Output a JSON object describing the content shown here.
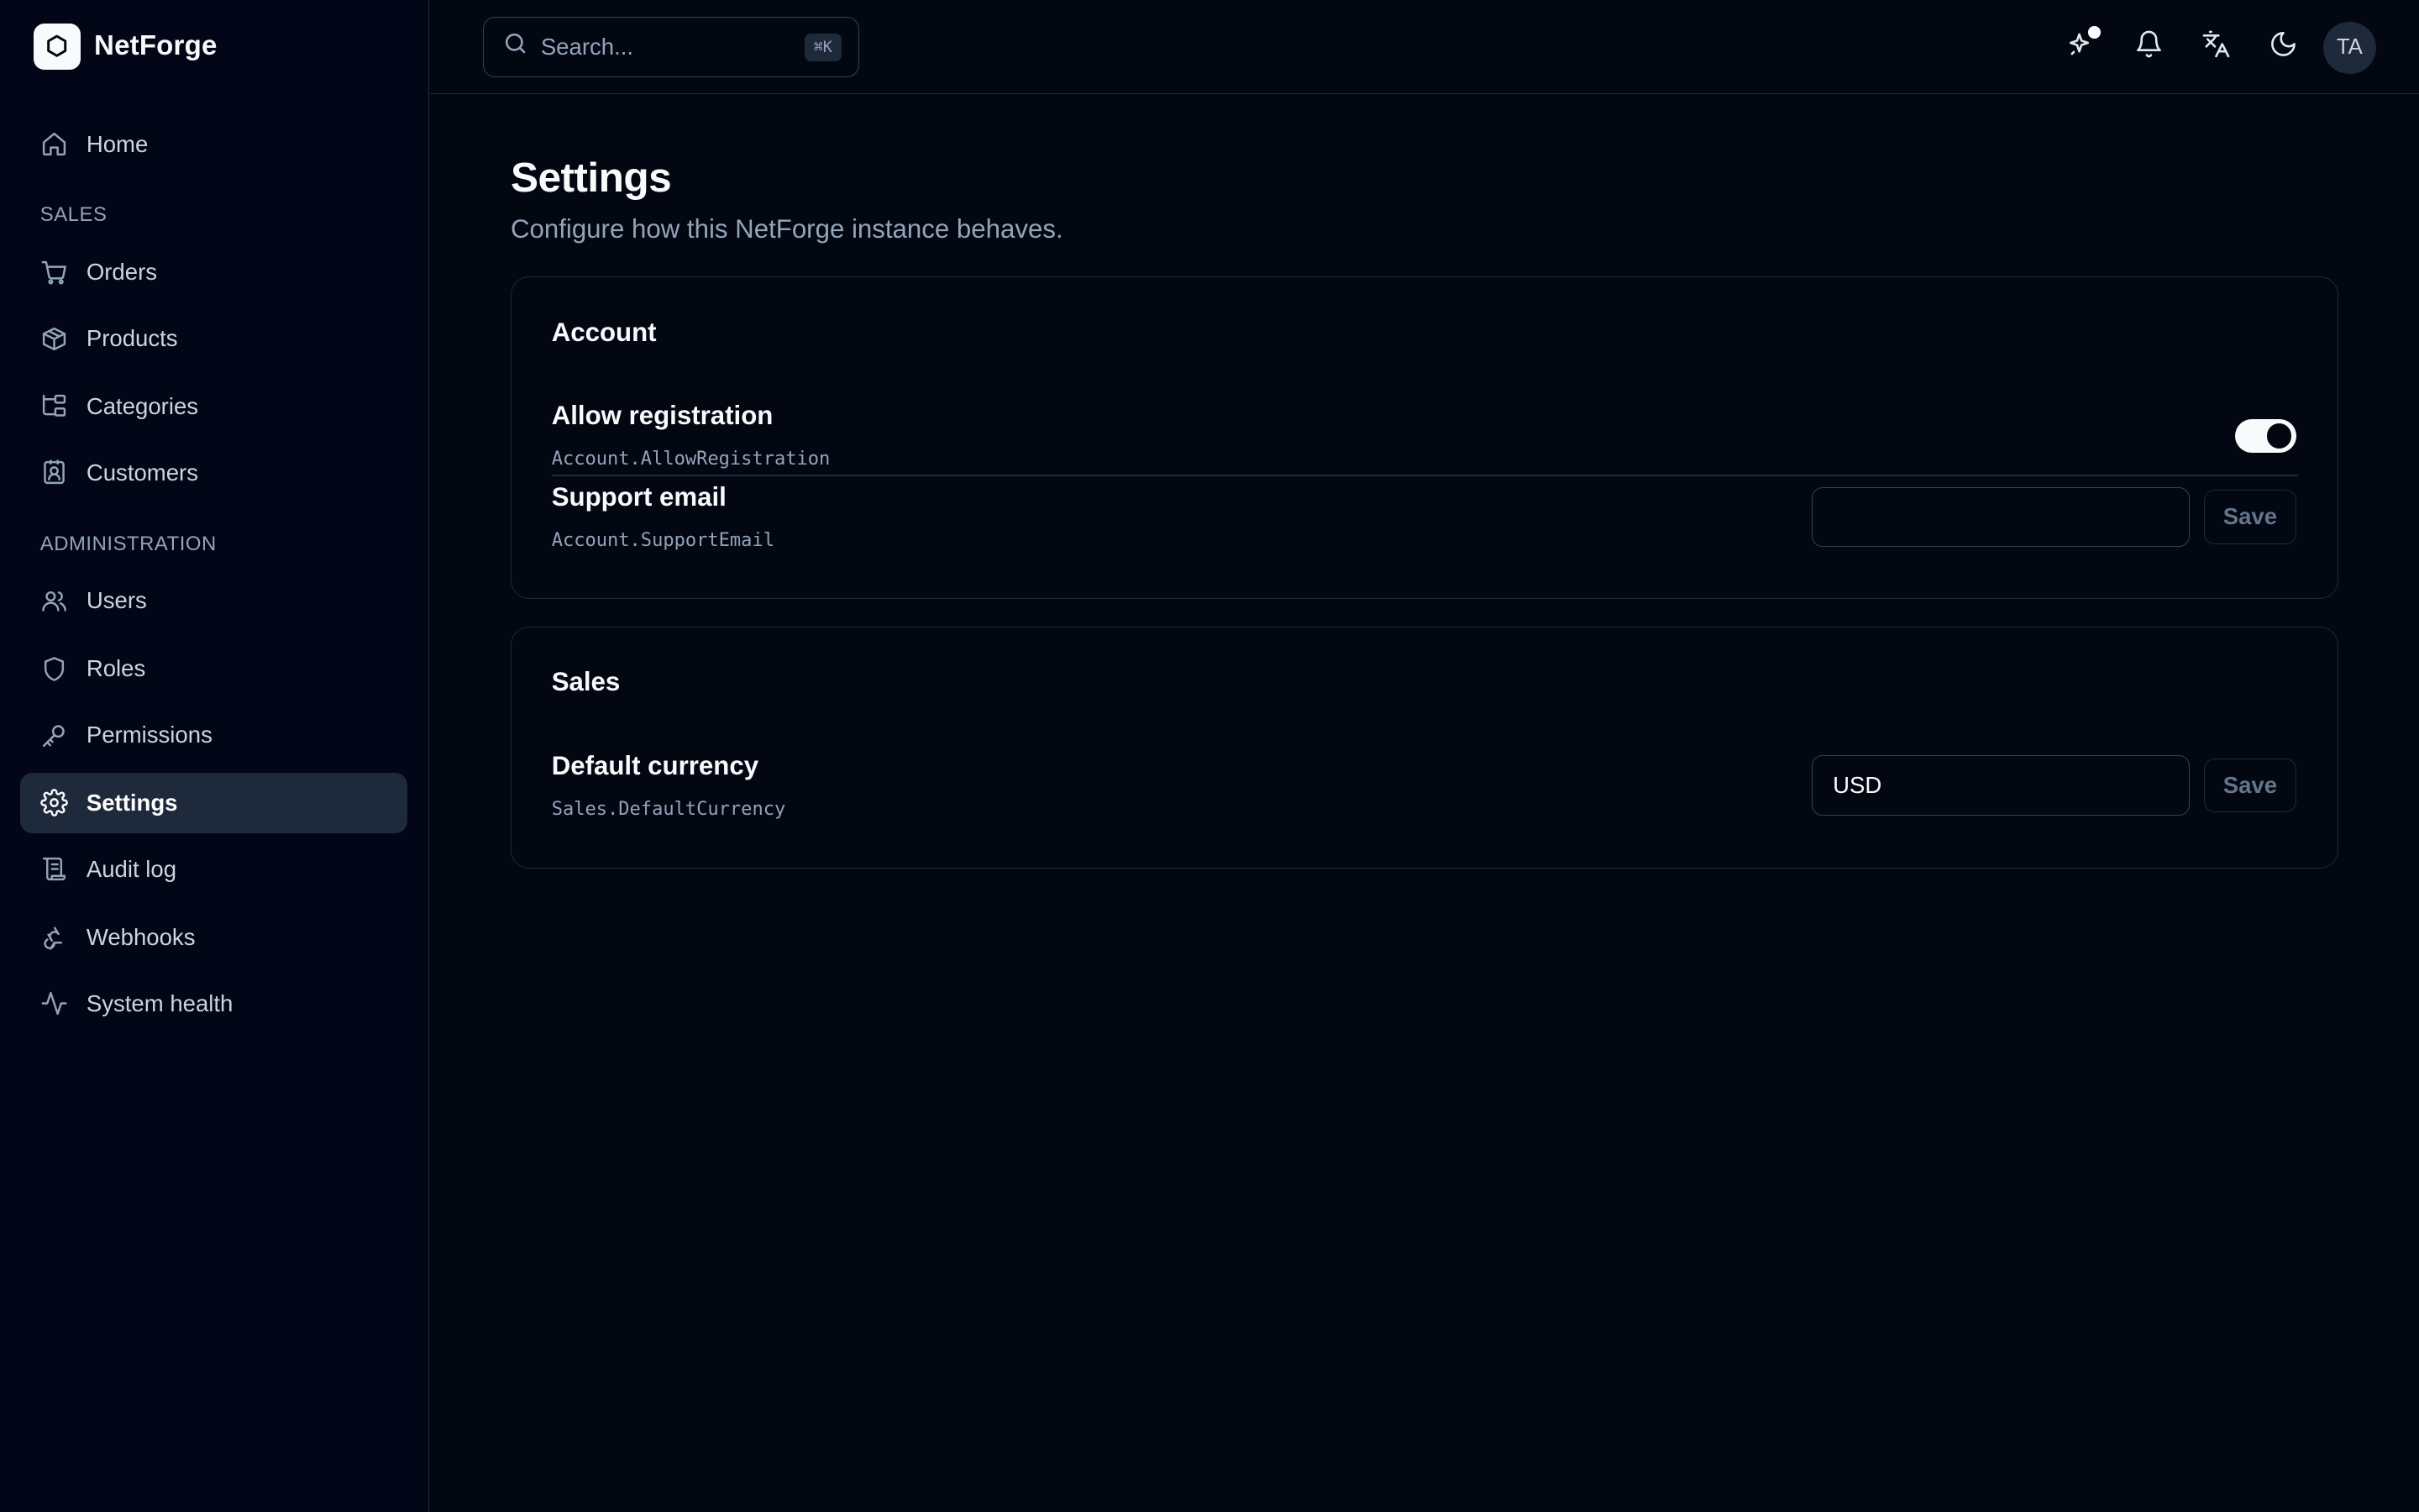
{
  "brand": {
    "name": "NetForge"
  },
  "sidebar": {
    "home": {
      "label": "Home",
      "icon": "home-icon"
    },
    "sections": {
      "sales": "SALES",
      "administration": "ADMINISTRATION"
    },
    "items": [
      {
        "label": "Orders",
        "icon": "shopping-cart-icon"
      },
      {
        "label": "Products",
        "icon": "package-icon"
      },
      {
        "label": "Categories",
        "icon": "folder-tree-icon"
      },
      {
        "label": "Customers",
        "icon": "contact-icon"
      },
      {
        "label": "Users",
        "icon": "users-icon"
      },
      {
        "label": "Roles",
        "icon": "shield-icon"
      },
      {
        "label": "Permissions",
        "icon": "key-icon"
      },
      {
        "label": "Settings",
        "icon": "gear-icon",
        "active": true
      },
      {
        "label": "Audit log",
        "icon": "scroll-icon"
      },
      {
        "label": "Webhooks",
        "icon": "webhook-icon"
      },
      {
        "label": "System health",
        "icon": "activity-icon"
      }
    ]
  },
  "topbar": {
    "search": {
      "placeholder": "Search...",
      "shortcut": "⌘K"
    },
    "avatar_initials": "TA",
    "icons": [
      "sparkles-icon",
      "bell-icon",
      "languages-icon",
      "moon-icon"
    ]
  },
  "page": {
    "title": "Settings",
    "subtitle": "Configure how this NetForge instance behaves."
  },
  "cards": {
    "account": {
      "title": "Account",
      "allow_registration": {
        "label": "Allow registration",
        "key": "Account.AllowRegistration",
        "enabled": true
      },
      "support_email": {
        "label": "Support email",
        "key": "Account.SupportEmail",
        "value": "",
        "save": "Save"
      }
    },
    "sales": {
      "title": "Sales",
      "default_currency": {
        "label": "Default currency",
        "key": "Sales.DefaultCurrency",
        "value": "USD",
        "save": "Save"
      }
    }
  },
  "colors": {
    "background": "#030712",
    "sidebar": "#020617",
    "border": "#1e293b",
    "active": "#1e293b",
    "text": "#f8fafc",
    "muted": "#94a3b8"
  }
}
